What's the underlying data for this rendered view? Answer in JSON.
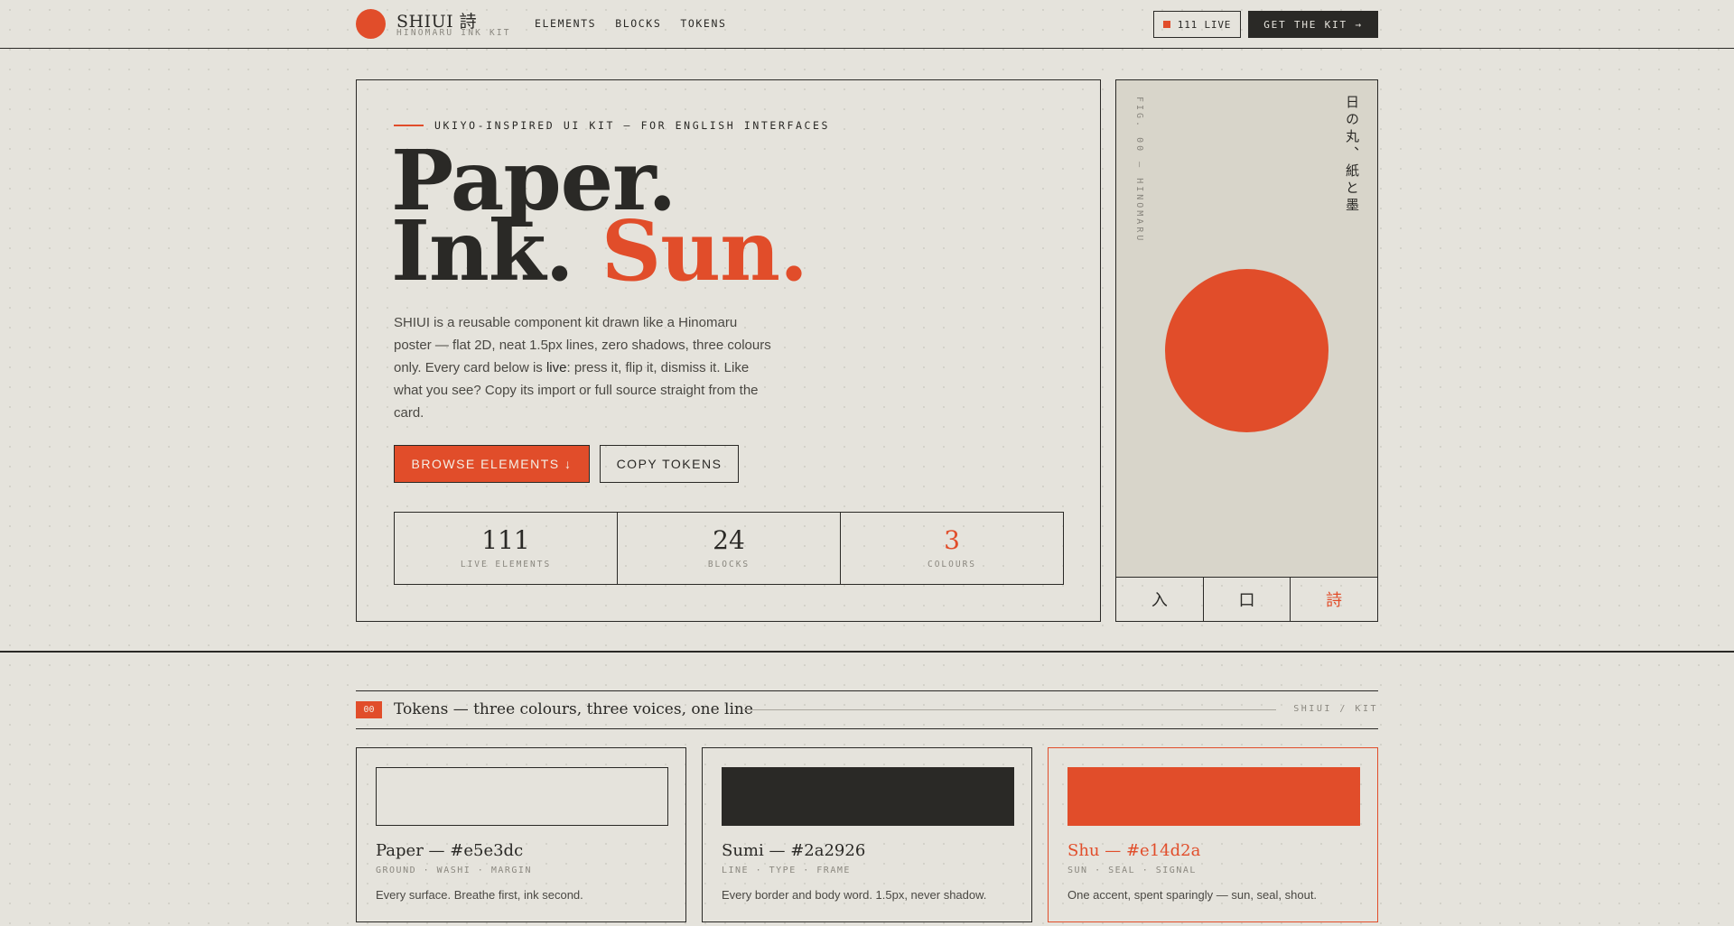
{
  "header": {
    "brand_name": "SHIUI 詩",
    "brand_sub": "HINOMARU INK KIT",
    "nav": [
      "ELEMENTS",
      "BLOCKS",
      "TOKENS"
    ],
    "live_label": "111 LIVE",
    "cta_label": "GET THE KIT →"
  },
  "hero": {
    "eyebrow": "UKIYO-INSPIRED UI KIT — FOR ENGLISH INTERFACES",
    "headline_line1": "Paper.",
    "headline_line2_a": "Ink.",
    "headline_line2_b": "Sun.",
    "intro_a": "SHIUI is a reusable component kit drawn like a Hinomaru poster — flat 2D, neat 1.5px lines, zero shadows, three colours only. Every card below is ",
    "intro_live": "live",
    "intro_b": ": press it, flip it, dismiss it. Like what you see? Copy its import or full source straight from the card.",
    "primary_button": "BROWSE ELEMENTS ↓",
    "secondary_button": "COPY TOKENS",
    "stats": [
      {
        "value": "111",
        "label": "LIVE ELEMENTS"
      },
      {
        "value": "24",
        "label": "BLOCKS"
      },
      {
        "value": "3",
        "label": "COLOURS"
      }
    ]
  },
  "poster": {
    "fig_label": "FIG. 00 — HINOMARU",
    "poem": "日の丸、紙と墨",
    "tabs": [
      "入",
      "口",
      "詩"
    ]
  },
  "section": {
    "badge": "00",
    "title": "Tokens — three colours, three voices, one line",
    "meta": "SHIUI / KIT"
  },
  "tokens": [
    {
      "name": "Paper — #e5e3dc",
      "tags": "GROUND · WASHI · MARGIN",
      "desc": "Every surface. Breathe first, ink second.",
      "color": "#e5e3dc"
    },
    {
      "name": "Sumi — #2a2926",
      "tags": "LINE · TYPE · FRAME",
      "desc": "Every border and body word. 1.5px, never shadow.",
      "color": "#2a2926"
    },
    {
      "name": "Shu — #e14d2a",
      "tags": "SUN · SEAL · SIGNAL",
      "desc": "One accent, spent sparingly — sun, seal, shout.",
      "color": "#e14d2a"
    }
  ],
  "colors": {
    "paper": "#e5e3dc",
    "sumi": "#2a2926",
    "shu": "#e14d2a"
  }
}
